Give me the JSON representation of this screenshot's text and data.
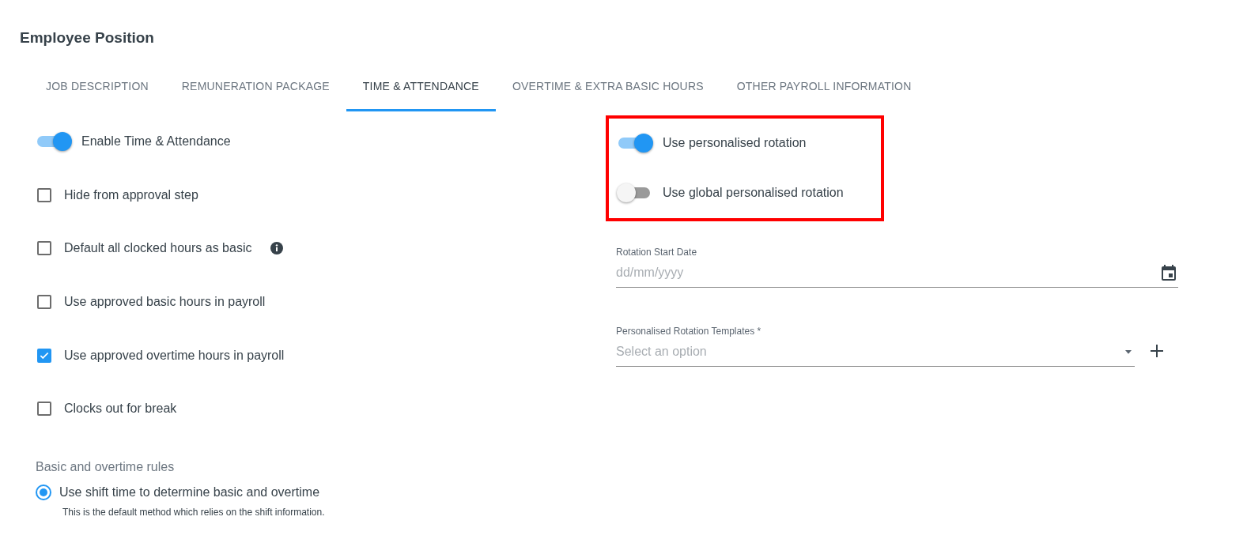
{
  "title": "Employee Position",
  "tabs": [
    {
      "label": "JOB DESCRIPTION",
      "selected": false
    },
    {
      "label": "REMUNERATION PACKAGE",
      "selected": false
    },
    {
      "label": "TIME & ATTENDANCE",
      "selected": true
    },
    {
      "label": "OVERTIME & EXTRA BASIC HOURS",
      "selected": false
    },
    {
      "label": "OTHER PAYROLL INFORMATION",
      "selected": false
    }
  ],
  "left_options": [
    {
      "kind": "switch",
      "label": "Enable Time & Attendance",
      "on": true
    },
    {
      "kind": "checkbox",
      "label": "Hide from approval step",
      "checked": false
    },
    {
      "kind": "checkbox",
      "label": "Default all clocked hours as basic",
      "checked": false,
      "info": true
    },
    {
      "kind": "checkbox",
      "label": "Use approved basic hours in payroll",
      "checked": false
    },
    {
      "kind": "checkbox",
      "label": "Use approved overtime hours in payroll",
      "checked": true
    },
    {
      "kind": "checkbox",
      "label": "Clocks out for break",
      "checked": false
    }
  ],
  "rules": {
    "heading": "Basic and overtime rules",
    "options": [
      {
        "label": "Use shift time to determine basic and overtime",
        "description": "This is the default method which relies on the shift information.",
        "selected": true
      }
    ]
  },
  "rotation": {
    "highlighted": true,
    "switches": [
      {
        "label": "Use personalised rotation",
        "on": true
      },
      {
        "label": "Use global personalised rotation",
        "on": false
      }
    ]
  },
  "start_date": {
    "label": "Rotation Start Date",
    "placeholder": "dd/mm/yyyy"
  },
  "templates": {
    "label": "Personalised Rotation Templates *",
    "placeholder": "Select an option"
  }
}
